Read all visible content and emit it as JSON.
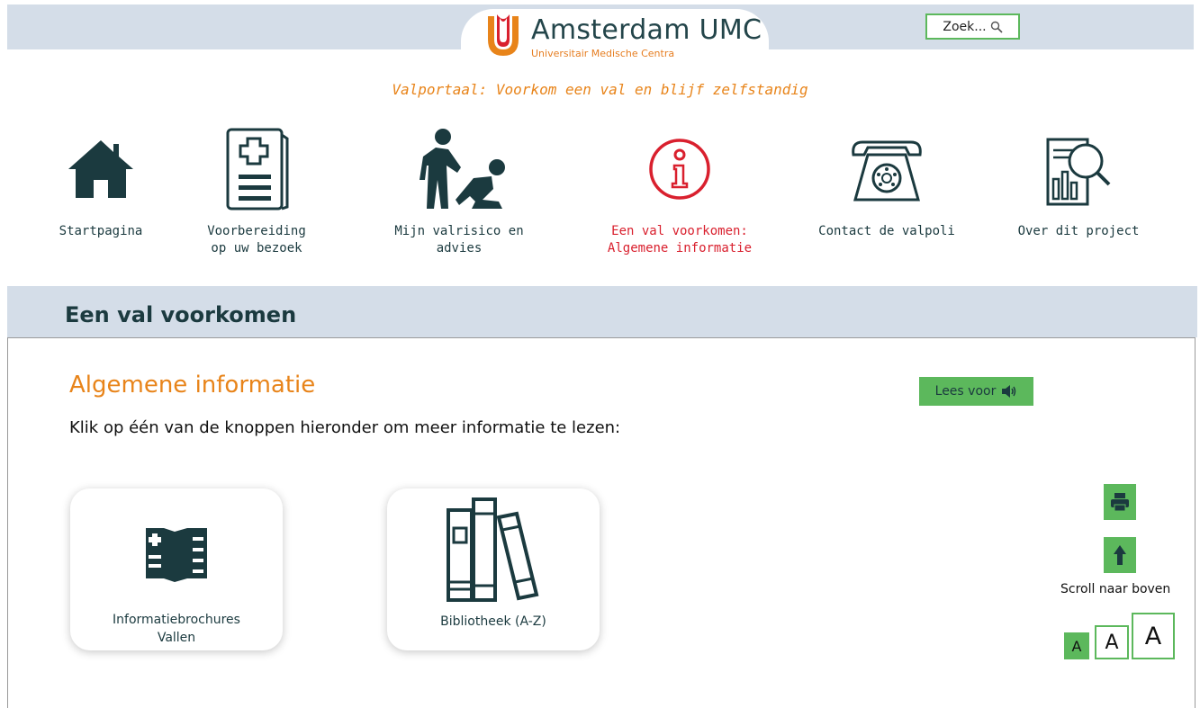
{
  "header": {
    "logo_name": "Amsterdam UMC",
    "logo_sub": "Universitair Medische Centra",
    "search_label": "Zoek...",
    "tagline": "Valportaal: Voorkom een val en blijf zelfstandig"
  },
  "nav": [
    {
      "label": "Startpagina",
      "icon": "house-icon"
    },
    {
      "label": "Voorbereiding\nop uw bezoek",
      "icon": "clipboard-icon"
    },
    {
      "label": "Mijn valrisico en advies",
      "icon": "helping-person-icon"
    },
    {
      "label": "Een val voorkomen:\nAlgemene informatie",
      "icon": "info-icon",
      "active": true
    },
    {
      "label": "Contact de valpoli",
      "icon": "telephone-icon"
    },
    {
      "label": "Over dit project",
      "icon": "report-search-icon"
    }
  ],
  "section": {
    "title": "Een val voorkomen"
  },
  "main": {
    "heading": "Algemene informatie",
    "intro": "Klik op één van de knoppen hieronder om meer informatie te lezen:",
    "read_aloud": "Lees voor",
    "cards": [
      {
        "label": "Informatiebrochures\nVallen",
        "icon": "brochure-icon"
      },
      {
        "label": "Bibliotheek (A-Z)",
        "icon": "books-icon"
      }
    ]
  },
  "tools": {
    "scroll_label": "Scroll naar boven",
    "font_sizes": [
      "A",
      "A",
      "A"
    ]
  },
  "colors": {
    "accent_green": "#5cb85c",
    "orange": "#e8841a",
    "active_red": "#d9202e",
    "band": "#d4dde8",
    "dark_teal": "#1b3a3f"
  }
}
